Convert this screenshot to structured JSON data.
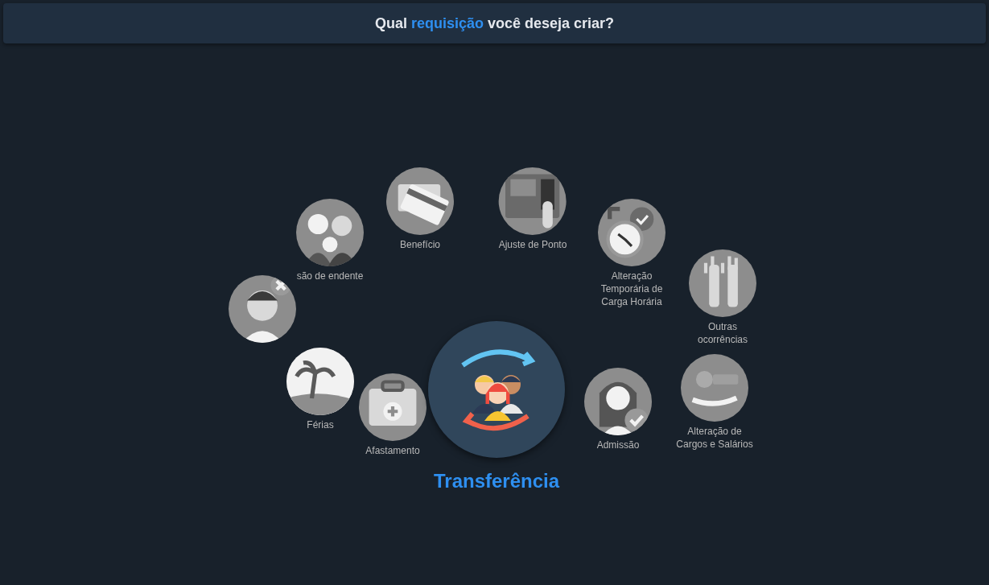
{
  "header": {
    "title_before": "Qual",
    "title_highlight": "requisição",
    "title_after": "você deseja criar?"
  },
  "options": [
    {
      "label": "Benefício",
      "selected": false
    },
    {
      "label": "Ajuste de Ponto",
      "selected": false
    },
    {
      "label": "são de endente",
      "selected": false
    },
    {
      "label": "Alteração Temporária de Carga Horária",
      "selected": false
    },
    {
      "selected": false
    },
    {
      "label": "Outras ocorrências",
      "selected": false
    },
    {
      "label": "Férias",
      "selected": false
    },
    {
      "label": "Afastamento",
      "selected": false
    },
    {
      "label": "Transferência",
      "selected": true
    },
    {
      "label": "Admissão",
      "selected": false
    },
    {
      "label": "Alteração de Cargos e Salários",
      "selected": false
    }
  ]
}
